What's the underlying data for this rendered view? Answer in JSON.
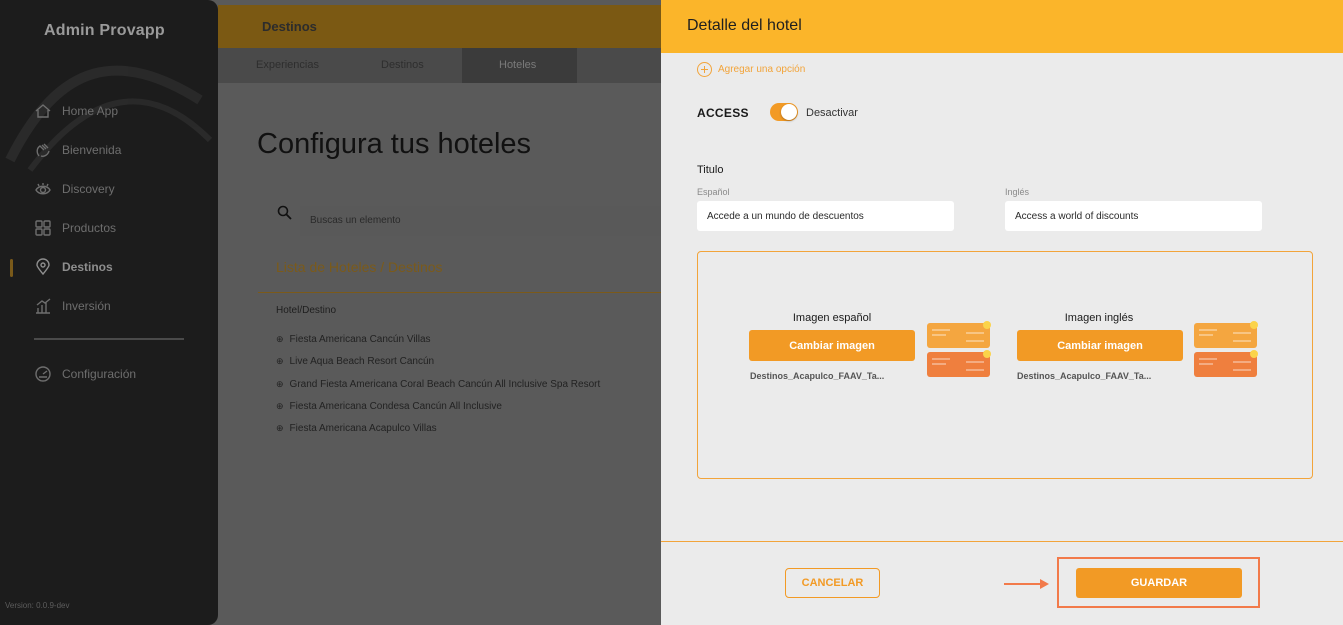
{
  "sidebar": {
    "brand": "Admin Provapp",
    "items": [
      {
        "label": "Home App",
        "icon": "home-icon"
      },
      {
        "label": "Bienvenida",
        "icon": "wave-hand-icon"
      },
      {
        "label": "Discovery",
        "icon": "eye-icon"
      },
      {
        "label": "Productos",
        "icon": "grid-icon"
      },
      {
        "label": "Destinos",
        "icon": "map-pin-icon",
        "active": true
      },
      {
        "label": "Inversión",
        "icon": "bar-chart-icon"
      }
    ],
    "settings": {
      "label": "Configuración",
      "icon": "gauge-icon"
    },
    "version": "Version: 0.0.9-dev"
  },
  "header": {
    "title": "Destinos"
  },
  "tabs": [
    {
      "label": "Experiencias"
    },
    {
      "label": "Destinos"
    },
    {
      "label": "Hoteles",
      "active": true
    }
  ],
  "main": {
    "title": "Configura tus hoteles",
    "search_placeholder": "Buscas un elemento",
    "list_title": "Lista de Hoteles / Destinos",
    "column_header": "Hotel/Destino",
    "hotels": [
      "Fiesta Americana Cancún Villas",
      "Live Aqua Beach Resort Cancún",
      "Grand Fiesta Americana Coral Beach Cancún All Inclusive Spa Resort",
      "Fiesta Americana Condesa Cancún All Inclusive",
      "Fiesta Americana Acapulco Villas"
    ]
  },
  "panel": {
    "title": "Detalle del hotel",
    "add_option": "Agregar una opción",
    "access_label": "ACCESS",
    "toggle_label": "Desactivar",
    "toggle_on": true,
    "title_section": "Titulo",
    "spanish_label": "Español",
    "spanish_value": "Accede a un mundo de descuentos",
    "english_label": "Inglés",
    "english_value": "Access a world of discounts",
    "image_es_label": "Imagen español",
    "image_en_label": "Imagen inglés",
    "change_image": "Cambiar imagen",
    "file_es": "Destinos_Acapulco_FAAV_Ta...",
    "file_en": "Destinos_Acapulco_FAAV_Ta...",
    "cancel": "CANCELAR",
    "save": "GUARDAR"
  },
  "colors": {
    "accent": "#fbb52a",
    "button": "#f29a25",
    "highlight": "#f27a4a"
  }
}
